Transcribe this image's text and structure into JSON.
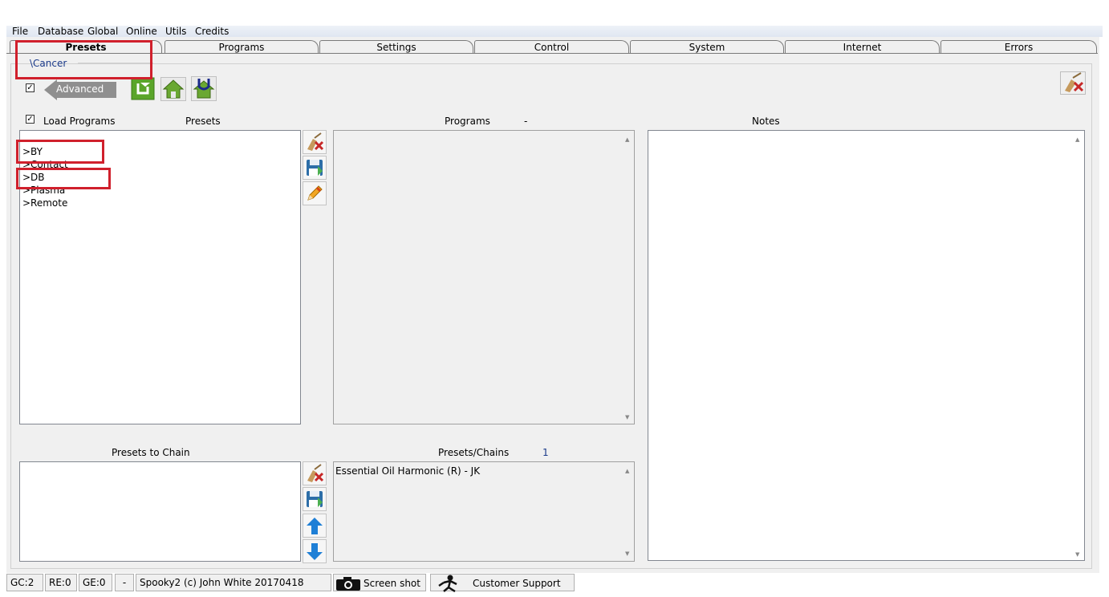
{
  "menu": [
    "File",
    "Database",
    "Global",
    "Online",
    "Utils",
    "Credits"
  ],
  "tabs": [
    "Presets",
    "Programs",
    "Settings",
    "Control",
    "System",
    "Internet",
    "Errors"
  ],
  "active_tab": "Presets",
  "path": "\\Cancer",
  "advanced_label": "Advanced",
  "load_programs": {
    "label": "Load Programs",
    "checked": true
  },
  "advanced_checked": true,
  "headers": {
    "presets": "Presets",
    "programs": "Programs",
    "programs_count": "-",
    "notes": "Notes",
    "presets_to_chain": "Presets to Chain",
    "presets_chains": "Presets/Chains",
    "presets_chains_count": "1"
  },
  "preset_items": [
    ">BY",
    ">Contact",
    ">DB",
    ">Plasma",
    ">Remote"
  ],
  "chain_items": [
    "Essential Oil Harmonic (R) - JK"
  ],
  "status": {
    "gc": "GC:2",
    "re": "RE:0",
    "ge": "GE:0",
    "dash": "-",
    "copyright": "Spooky2 (c) John White 20170418",
    "screenshot": "Screen shot",
    "support": "Customer Support"
  },
  "colors": {
    "highlight_box": "#d0202c",
    "icon_green": "#5aa52a",
    "icon_blue": "#1e7fd6"
  }
}
